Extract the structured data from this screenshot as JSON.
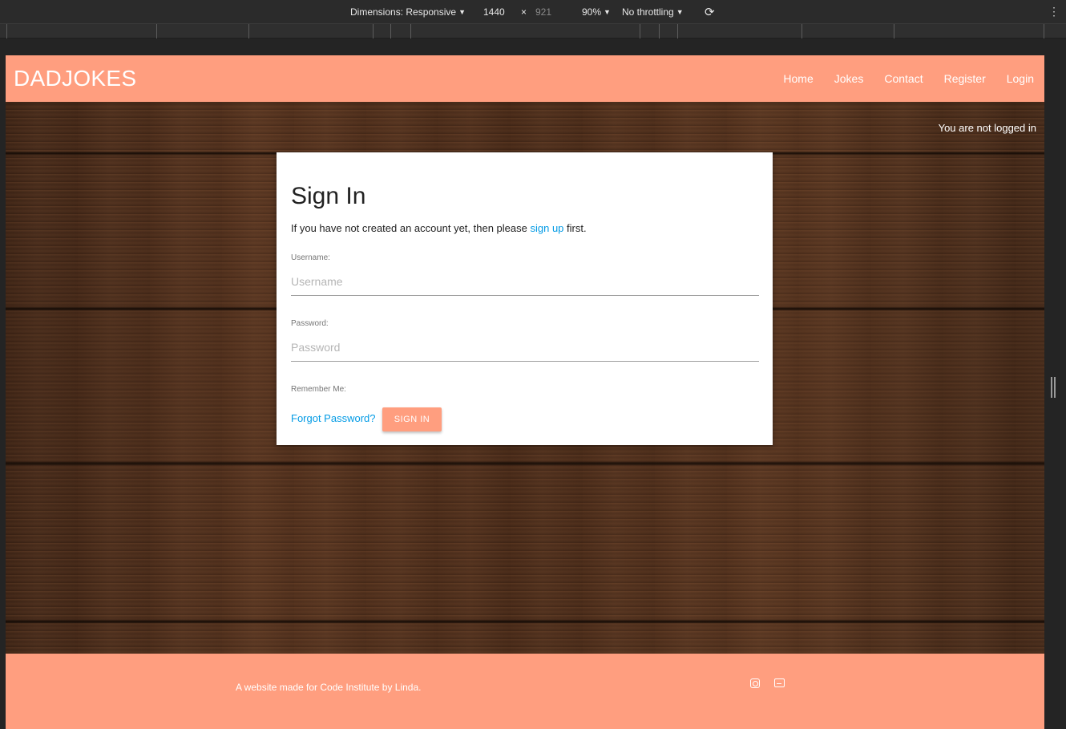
{
  "devtools": {
    "dimensions_label": "Dimensions: Responsive",
    "width": "1440",
    "times": "×",
    "height": "921",
    "zoom": "90%",
    "throttling": "No throttling",
    "kebab": "⋮",
    "rotate": "⟳"
  },
  "navbar": {
    "brand": "DADJOKES",
    "links": [
      "Home",
      "Jokes",
      "Contact",
      "Register",
      "Login"
    ]
  },
  "status": "You are not logged in",
  "signin": {
    "title": "Sign In",
    "intro_before": "If you have not created an account yet, then please ",
    "intro_link": "sign up",
    "intro_after": " first.",
    "username_label": "Username:",
    "username_placeholder": "Username",
    "password_label": "Password:",
    "password_placeholder": "Password",
    "remember_label": "Remember Me:",
    "forgot_link": "Forgot Password?",
    "button": "SIGN IN"
  },
  "footer": {
    "text": "A website made for Code Institute by Linda.",
    "icons": [
      "instagram-icon",
      "youtube-icon"
    ]
  },
  "colors": {
    "accent": "#ff9e7f",
    "link": "#039be5"
  }
}
